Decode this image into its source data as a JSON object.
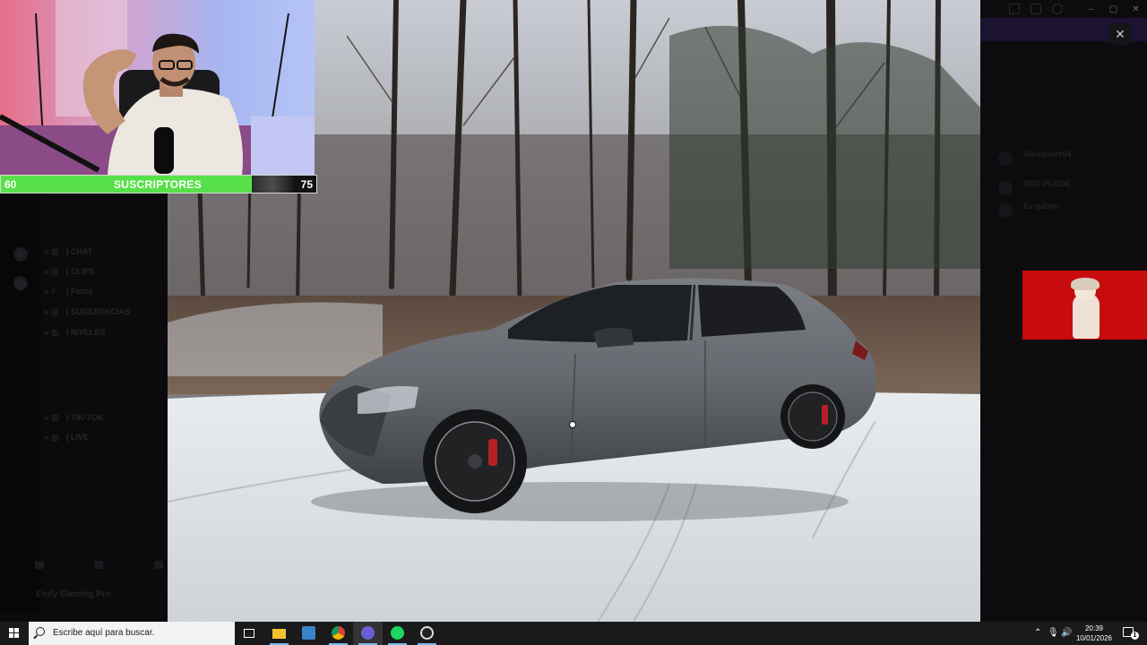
{
  "stream_overlay": {
    "goal": {
      "current": "60",
      "label": "SUSCRIPTORES",
      "target": "75",
      "progress": 0.8
    },
    "webcam": "streamer-webcam"
  },
  "background_app": {
    "channels": [
      "CHAT",
      "CLIPS",
      "Fotos",
      "SUGERENCIAS",
      "NIVELES",
      "TIK-TOK",
      "LIVE"
    ],
    "user": {
      "name": "Endy Gaming Pro"
    },
    "members": [
      "Alexander04",
      "NOS PUEDE",
      "Ex gaboo"
    ],
    "window_controls": [
      "minimize",
      "maximize",
      "close"
    ]
  },
  "viewer": {
    "close_label": "✕",
    "photo": "grey-sedan-in-snowy-forest"
  },
  "taskbar": {
    "search_placeholder": "Escribe aquí para buscar.",
    "apps": [
      "task-view",
      "file-explorer",
      "store",
      "chrome",
      "discord-browser",
      "spotify",
      "obs"
    ],
    "clock": {
      "time": "20:39",
      "date": "10/01/2026"
    },
    "notifications": "1"
  }
}
